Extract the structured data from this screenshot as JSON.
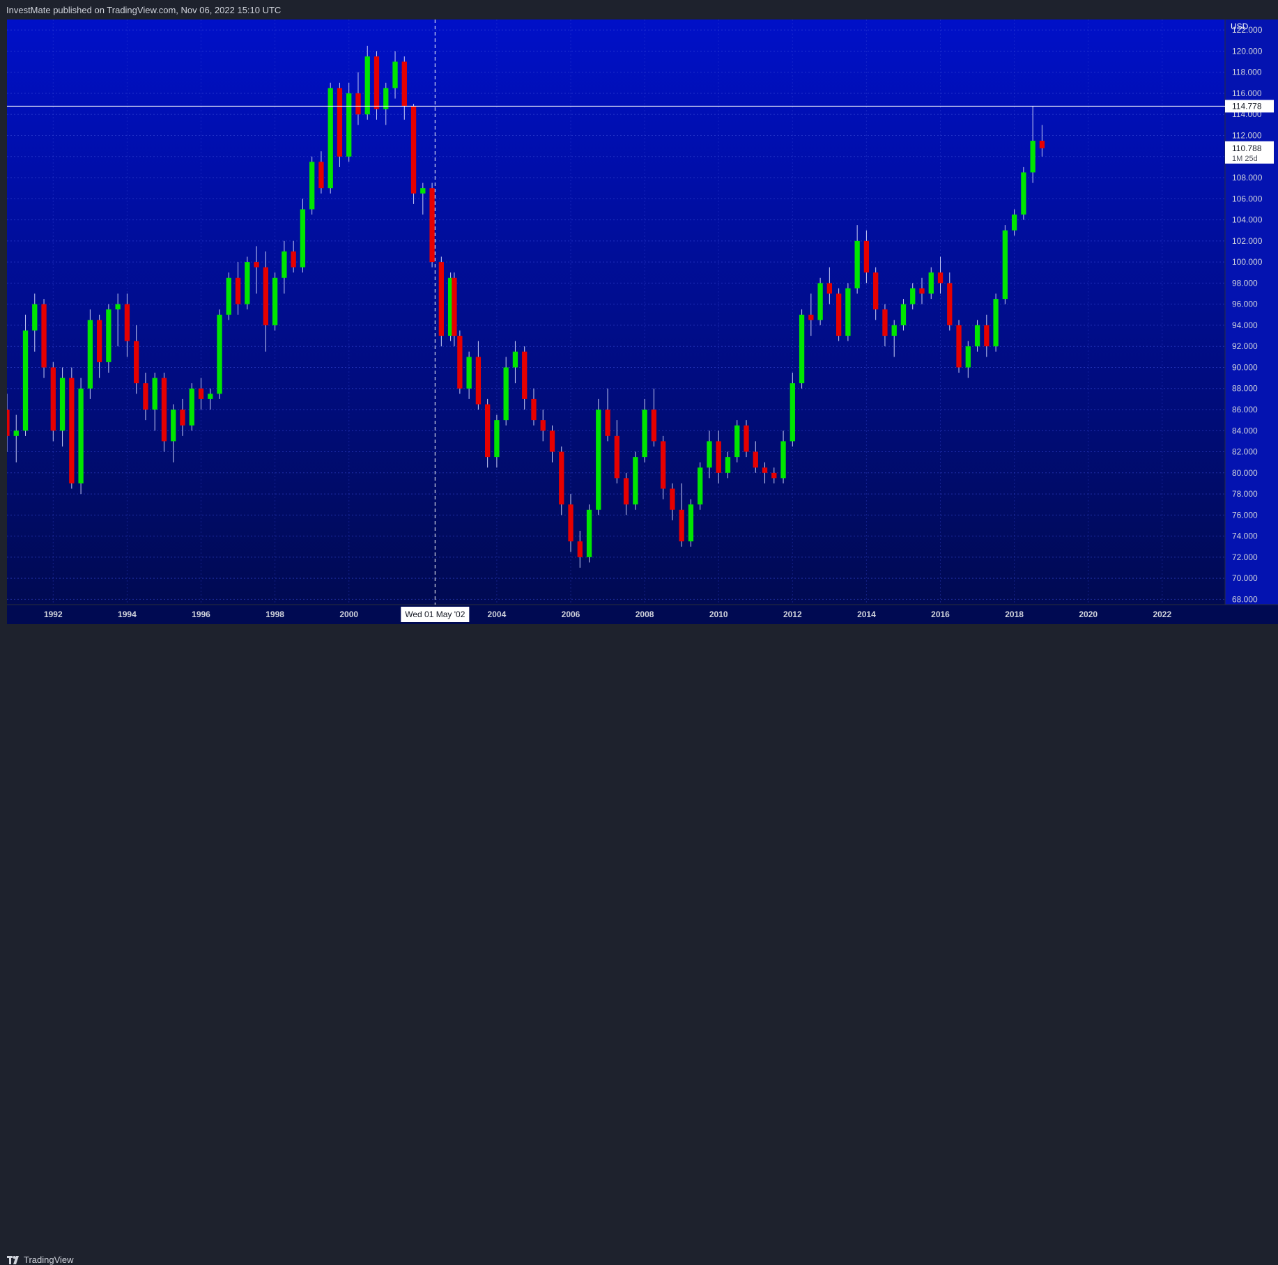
{
  "header": {
    "publish_info": "InvestMate published on TradingView.com, Nov 06, 2022 15:10 UTC"
  },
  "footer": {
    "logo_text": "TradingView"
  },
  "colors": {
    "up": "#00e600",
    "down": "#e60000",
    "background_top": "#0010c8",
    "background_bottom": "#000a52",
    "crosshair": "#ffffff"
  },
  "chart_data": {
    "type": "candlestick",
    "interval": "1M",
    "currency_label": "USD",
    "x_tick_labels": [
      "1992",
      "1994",
      "1996",
      "1998",
      "2000",
      "2004",
      "2006",
      "2008",
      "2010",
      "2012",
      "2014",
      "2016",
      "2018",
      "2020",
      "2022"
    ],
    "xlim": [
      1990.75,
      2023.7
    ],
    "ylim": [
      67.5,
      123.0
    ],
    "y_tick_labels": [
      "68.000",
      "70.000",
      "72.000",
      "74.000",
      "76.000",
      "78.000",
      "80.000",
      "82.000",
      "84.000",
      "86.000",
      "88.000",
      "90.000",
      "92.000",
      "94.000",
      "96.000",
      "98.000",
      "100.000",
      "102.000",
      "104.000",
      "106.000",
      "108.000",
      "110.000",
      "112.000",
      "114.000",
      "116.000",
      "118.000",
      "120.000",
      "122.000"
    ],
    "crosshair": {
      "x_label": "Wed 01 May '02",
      "x_value": 2002.33,
      "y_label": "114.778",
      "y_value": 114.778
    },
    "last_price": {
      "value_label": "110.788",
      "value": 110.788,
      "countdown": "1M 25d"
    },
    "candles": [
      [
        1990.75,
        86.0,
        87.5,
        82.0,
        83.5
      ],
      [
        1991.0,
        83.5,
        85.5,
        81.0,
        84.0
      ],
      [
        1991.25,
        84.0,
        95.0,
        83.5,
        93.5
      ],
      [
        1991.5,
        93.5,
        97.0,
        91.5,
        96.0
      ],
      [
        1991.75,
        96.0,
        96.5,
        89.0,
        90.0
      ],
      [
        1992.0,
        90.0,
        90.5,
        83.0,
        84.0
      ],
      [
        1992.25,
        84.0,
        90.0,
        82.5,
        89.0
      ],
      [
        1992.5,
        89.0,
        90.0,
        78.5,
        79.0
      ],
      [
        1992.75,
        79.0,
        89.0,
        78.0,
        88.0
      ],
      [
        1993.0,
        88.0,
        95.5,
        87.0,
        94.5
      ],
      [
        1993.25,
        94.5,
        95.0,
        89.0,
        90.5
      ],
      [
        1993.5,
        90.5,
        96.0,
        89.5,
        95.5
      ],
      [
        1993.75,
        95.5,
        97.0,
        92.0,
        96.0
      ],
      [
        1994.0,
        96.0,
        97.0,
        91.0,
        92.5
      ],
      [
        1994.25,
        92.5,
        94.0,
        87.5,
        88.5
      ],
      [
        1994.5,
        88.5,
        89.5,
        85.0,
        86.0
      ],
      [
        1994.75,
        86.0,
        89.5,
        84.0,
        89.0
      ],
      [
        1995.0,
        89.0,
        89.5,
        82.0,
        83.0
      ],
      [
        1995.25,
        83.0,
        86.5,
        81.0,
        86.0
      ],
      [
        1995.5,
        86.0,
        87.0,
        83.5,
        84.5
      ],
      [
        1995.75,
        84.5,
        88.5,
        84.0,
        88.0
      ],
      [
        1996.0,
        88.0,
        89.0,
        86.0,
        87.0
      ],
      [
        1996.25,
        87.0,
        88.0,
        86.0,
        87.5
      ],
      [
        1996.5,
        87.5,
        95.5,
        87.0,
        95.0
      ],
      [
        1996.75,
        95.0,
        99.0,
        94.5,
        98.5
      ],
      [
        1997.0,
        98.5,
        100.0,
        95.0,
        96.0
      ],
      [
        1997.25,
        96.0,
        100.5,
        95.5,
        100.0
      ],
      [
        1997.5,
        100.0,
        101.5,
        97.0,
        99.5
      ],
      [
        1997.75,
        99.5,
        101.0,
        91.5,
        94.0
      ],
      [
        1998.0,
        94.0,
        99.0,
        93.5,
        98.5
      ],
      [
        1998.25,
        98.5,
        102.0,
        97.0,
        101.0
      ],
      [
        1998.5,
        101.0,
        102.0,
        99.0,
        99.5
      ],
      [
        1998.75,
        99.5,
        106.0,
        99.0,
        105.0
      ],
      [
        1999.0,
        105.0,
        110.0,
        104.5,
        109.5
      ],
      [
        1999.25,
        109.5,
        110.5,
        106.5,
        107.0
      ],
      [
        1999.5,
        107.0,
        117.0,
        106.5,
        116.5
      ],
      [
        1999.75,
        116.5,
        117.0,
        109.0,
        110.0
      ],
      [
        2000.0,
        110.0,
        117.0,
        109.5,
        116.0
      ],
      [
        2000.25,
        116.0,
        118.0,
        113.0,
        114.0
      ],
      [
        2000.5,
        114.0,
        120.5,
        113.5,
        119.5
      ],
      [
        2000.75,
        119.5,
        120.0,
        113.5,
        114.5
      ],
      [
        2001.0,
        114.5,
        117.0,
        113.0,
        116.5
      ],
      [
        2001.25,
        116.5,
        120.0,
        115.5,
        119.0
      ],
      [
        2001.5,
        119.0,
        119.5,
        113.5,
        114.8
      ],
      [
        2001.75,
        114.8,
        115.0,
        105.5,
        106.5
      ],
      [
        2002.0,
        106.5,
        107.5,
        104.5,
        107.0
      ],
      [
        2002.25,
        107.0,
        107.5,
        99.5,
        100.0
      ],
      [
        2002.5,
        100.0,
        100.5,
        92.0,
        93.0
      ],
      [
        2002.75,
        93.0,
        99.0,
        92.5,
        98.5
      ],
      [
        2002.85,
        98.5,
        99.0,
        92.0,
        93.0
      ],
      [
        2003.0,
        93.0,
        93.5,
        87.5,
        88.0
      ],
      [
        2003.25,
        88.0,
        91.5,
        87.0,
        91.0
      ],
      [
        2003.5,
        91.0,
        92.5,
        86.0,
        86.5
      ],
      [
        2003.75,
        86.5,
        87.0,
        80.5,
        81.5
      ],
      [
        2004.0,
        81.5,
        85.5,
        80.5,
        85.0
      ],
      [
        2004.25,
        85.0,
        91.0,
        84.5,
        90.0
      ],
      [
        2004.5,
        90.0,
        92.5,
        88.5,
        91.5
      ],
      [
        2004.75,
        91.5,
        92.0,
        86.0,
        87.0
      ],
      [
        2005.0,
        87.0,
        88.0,
        84.5,
        85.0
      ],
      [
        2005.25,
        85.0,
        86.0,
        83.0,
        84.0
      ],
      [
        2005.5,
        84.0,
        84.5,
        81.0,
        82.0
      ],
      [
        2005.75,
        82.0,
        82.5,
        76.0,
        77.0
      ],
      [
        2006.0,
        77.0,
        78.0,
        72.5,
        73.5
      ],
      [
        2006.25,
        73.5,
        74.5,
        71.0,
        72.0
      ],
      [
        2006.5,
        72.0,
        77.0,
        71.5,
        76.5
      ],
      [
        2006.75,
        76.5,
        87.0,
        76.0,
        86.0
      ],
      [
        2007.0,
        86.0,
        88.0,
        83.0,
        83.5
      ],
      [
        2007.25,
        83.5,
        85.0,
        79.0,
        79.5
      ],
      [
        2007.5,
        79.5,
        80.0,
        76.0,
        77.0
      ],
      [
        2007.75,
        77.0,
        82.0,
        76.5,
        81.5
      ],
      [
        2008.0,
        81.5,
        87.0,
        81.0,
        86.0
      ],
      [
        2008.25,
        86.0,
        88.0,
        82.5,
        83.0
      ],
      [
        2008.5,
        83.0,
        83.5,
        77.5,
        78.5
      ],
      [
        2008.75,
        78.5,
        79.0,
        75.5,
        76.5
      ],
      [
        2009.0,
        76.5,
        79.0,
        73.0,
        73.5
      ],
      [
        2009.25,
        73.5,
        77.5,
        73.0,
        77.0
      ],
      [
        2009.5,
        77.0,
        81.0,
        76.5,
        80.5
      ],
      [
        2009.75,
        80.5,
        84.0,
        79.5,
        83.0
      ],
      [
        2010.0,
        83.0,
        84.0,
        79.0,
        80.0
      ],
      [
        2010.25,
        80.0,
        82.0,
        79.5,
        81.5
      ],
      [
        2010.5,
        81.5,
        85.0,
        81.0,
        84.5
      ],
      [
        2010.75,
        84.5,
        85.0,
        81.5,
        82.0
      ],
      [
        2011.0,
        82.0,
        83.0,
        80.0,
        80.5
      ],
      [
        2011.25,
        80.5,
        81.0,
        79.0,
        80.0
      ],
      [
        2011.5,
        80.0,
        80.5,
        79.0,
        79.5
      ],
      [
        2011.75,
        79.5,
        84.0,
        79.0,
        83.0
      ],
      [
        2012.0,
        83.0,
        89.5,
        82.5,
        88.5
      ],
      [
        2012.25,
        88.5,
        95.5,
        88.0,
        95.0
      ],
      [
        2012.5,
        95.0,
        97.0,
        93.0,
        94.5
      ],
      [
        2012.75,
        94.5,
        98.5,
        94.0,
        98.0
      ],
      [
        2013.0,
        98.0,
        99.5,
        96.0,
        97.0
      ],
      [
        2013.25,
        97.0,
        97.5,
        92.5,
        93.0
      ],
      [
        2013.5,
        93.0,
        98.0,
        92.5,
        97.5
      ],
      [
        2013.75,
        97.5,
        103.5,
        97.0,
        102.0
      ],
      [
        2014.0,
        102.0,
        103.0,
        98.0,
        99.0
      ],
      [
        2014.25,
        99.0,
        99.5,
        94.5,
        95.5
      ],
      [
        2014.5,
        95.5,
        96.0,
        92.0,
        93.0
      ],
      [
        2014.75,
        93.0,
        94.5,
        91.0,
        94.0
      ],
      [
        2015.0,
        94.0,
        96.5,
        93.5,
        96.0
      ],
      [
        2015.25,
        96.0,
        98.0,
        95.5,
        97.5
      ],
      [
        2015.5,
        97.5,
        98.5,
        96.0,
        97.0
      ],
      [
        2015.75,
        97.0,
        99.5,
        96.5,
        99.0
      ],
      [
        2016.0,
        99.0,
        100.5,
        97.0,
        98.0
      ],
      [
        2016.25,
        98.0,
        99.0,
        93.5,
        94.0
      ],
      [
        2016.5,
        94.0,
        94.5,
        89.5,
        90.0
      ],
      [
        2016.75,
        90.0,
        92.5,
        89.0,
        92.0
      ],
      [
        2017.0,
        92.0,
        94.5,
        91.5,
        94.0
      ],
      [
        2017.25,
        94.0,
        95.0,
        91.0,
        92.0
      ],
      [
        2017.5,
        92.0,
        97.0,
        91.5,
        96.5
      ],
      [
        2017.75,
        96.5,
        103.5,
        96.0,
        103.0
      ],
      [
        2018.0,
        103.0,
        105.0,
        102.5,
        104.5
      ],
      [
        2018.25,
        104.5,
        109.0,
        104.0,
        108.5
      ],
      [
        2018.5,
        108.5,
        114.778,
        107.5,
        111.5
      ],
      [
        2018.75,
        111.5,
        113.0,
        110.0,
        110.788
      ]
    ]
  }
}
